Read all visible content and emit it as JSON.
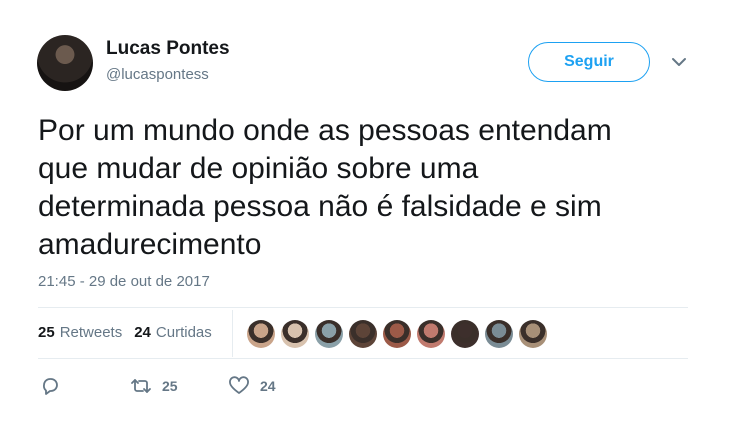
{
  "author": {
    "name": "Lucas Pontes",
    "handle": "@lucaspontess"
  },
  "follow_label": "Seguir",
  "tweet": {
    "lines": [
      "Por um mundo onde as pessoas entendam",
      "que mudar de opinião sobre uma",
      "determinada pessoa não é falsidade e sim",
      "amadurecimento"
    ],
    "timestamp": "21:45 - 29 de out de 2017"
  },
  "stats": {
    "retweets_count": "25",
    "retweets_label": "Retweets",
    "likes_count": "24",
    "likes_label": "Curtidas"
  },
  "liker_colors": [
    "#c9a48a",
    "#d8c2ae",
    "#8aa0a8",
    "#5d4438",
    "#9c5a48",
    "#c07a6e",
    "#3d2f2c",
    "#7a8c95",
    "#a89078"
  ],
  "actions": {
    "reply_icon": "reply-icon",
    "retweet_icon": "retweet-icon",
    "retweet_count": "25",
    "like_icon": "heart-icon",
    "like_count": "24"
  },
  "colors": {
    "accent": "#1da1f2",
    "muted": "#657786",
    "text": "#14171a"
  }
}
